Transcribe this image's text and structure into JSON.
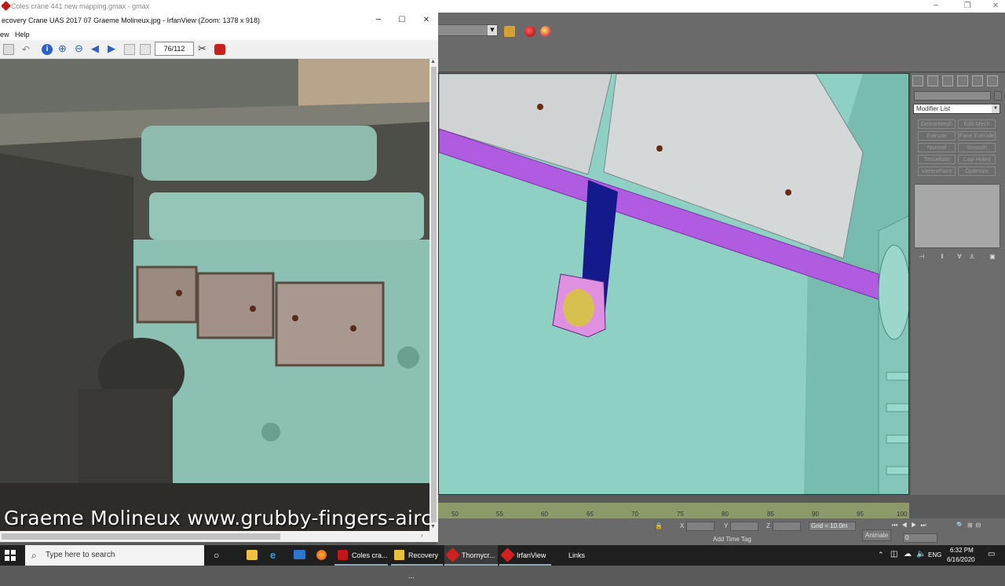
{
  "gmax": {
    "window_title": "Coles crane 441 new mapping.gmax - gmax",
    "modifier_list": "Modifier List",
    "modifier_buttons": [
      "DeleteMesh",
      "Edit Mesh",
      "Extrude",
      "Face Extrude",
      "Normal",
      "Smooth",
      "Tessellate",
      "Cap Holes",
      "VertexPaint",
      "Optimize"
    ],
    "timeline_ticks": [
      "50",
      "55",
      "60",
      "65",
      "70",
      "75",
      "80",
      "85",
      "90",
      "95",
      "100"
    ],
    "status": {
      "x_label": "X",
      "y_label": "Y",
      "z_label": "Z",
      "grid": "Grid = 10.0m",
      "add_time_tag": "Add Time Tag",
      "animate": "Animate",
      "frame": "0"
    }
  },
  "irfan": {
    "window_title": "ecovery Crane UAS 2017 07 Graeme Molineux.jpg - IrfanView (Zoom: 1378 x 918)",
    "menu": [
      "ew",
      "Help"
    ],
    "page_counter": "76/112",
    "watermark": "Graeme Molineux www.grubby-fingers-aircra"
  },
  "taskbar": {
    "search_placeholder": "Type here to search",
    "tasks": [
      "Coles cra...",
      "Recovery ...",
      "Thornycr...",
      "IrfanView",
      "Links"
    ],
    "language": "ENG",
    "time": "6:32 PM",
    "date": "6/16/2020"
  },
  "colors": {
    "viewport_bg": "#8fd0c4",
    "shaft": "#b05ce0",
    "bracket": "#141a8c",
    "flange": "#e090e0",
    "bearing": "#d8c050",
    "plates": "#d0d4d4"
  }
}
